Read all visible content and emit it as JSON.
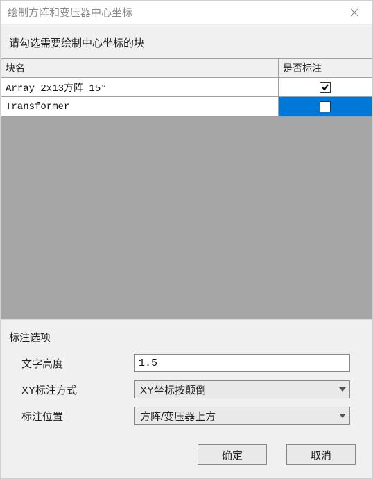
{
  "window": {
    "title": "绘制方阵和变压器中心坐标"
  },
  "instruction": "请勾选需要绘制中心坐标的块",
  "table": {
    "headers": {
      "name": "块名",
      "mark": "是否标注"
    },
    "rows": [
      {
        "name": "Array_2x13方阵_15°",
        "checked": true,
        "selected": false
      },
      {
        "name": "Transformer",
        "checked": false,
        "selected": true
      }
    ]
  },
  "options": {
    "section_title": "标注选项",
    "text_height_label": "文字高度",
    "text_height_value": "1.5",
    "xy_mode_label": "XY标注方式",
    "xy_mode_value": "XY坐标按颠倒",
    "position_label": "标注位置",
    "position_value": "方阵/变压器上方"
  },
  "buttons": {
    "ok": "确定",
    "cancel": "取消"
  }
}
